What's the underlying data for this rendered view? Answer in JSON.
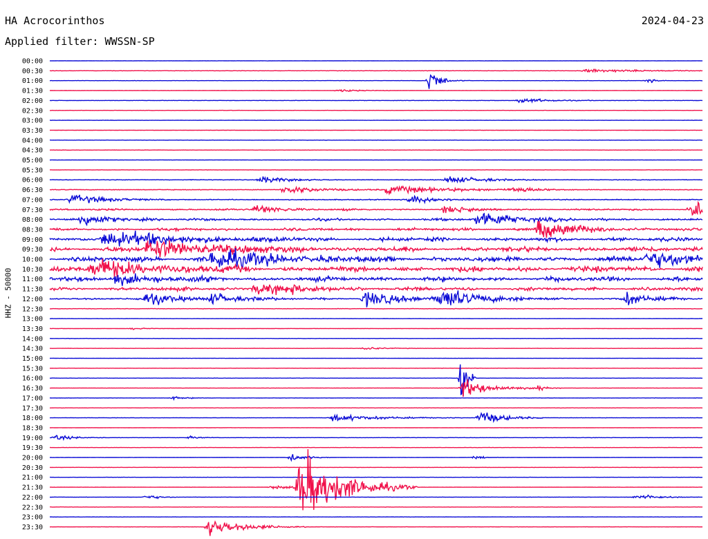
{
  "header": {
    "station": "HA Acrocorinthos",
    "date": "2024-04-23",
    "filter": "Applied filter: WWSSN-SP"
  },
  "colors": {
    "trace_a": "#0b0bd6",
    "trace_b": "#f0104a",
    "background": "#ffffff",
    "text": "#000000"
  },
  "chart_data": {
    "type": "line",
    "subtype": "helicorder",
    "title": "HA Acrocorinthos",
    "date": "2024-04-23",
    "filter": "Applied filter: WWSSN-SP",
    "ylabel": "HHZ - 50000",
    "xlabel": "",
    "minutes_per_line": 30,
    "grid": false,
    "alternate_colors": [
      "#0b0bd6",
      "#f0104a"
    ],
    "tick_labels": [
      "00:00",
      "00:30",
      "01:00",
      "01:30",
      "02:00",
      "02:30",
      "03:00",
      "03:30",
      "04:00",
      "04:30",
      "05:00",
      "05:30",
      "06:00",
      "06:30",
      "07:00",
      "07:30",
      "08:00",
      "08:30",
      "09:00",
      "09:30",
      "10:00",
      "10:30",
      "11:00",
      "11:30",
      "12:00",
      "12:30",
      "13:00",
      "13:30",
      "14:00",
      "14:30",
      "15:00",
      "15:30",
      "16:00",
      "16:30",
      "17:00",
      "17:30",
      "18:00",
      "18:30",
      "19:00",
      "19:30",
      "20:00",
      "20:30",
      "21:00",
      "21:30",
      "22:00",
      "22:30",
      "23:00",
      "23:30"
    ],
    "line_activity": [
      0.25,
      0.3,
      0.25,
      0.25,
      0.35,
      0.25,
      0.25,
      0.25,
      0.25,
      0.25,
      0.25,
      0.25,
      0.5,
      0.6,
      0.8,
      1.0,
      1.3,
      1.6,
      2.2,
      2.8,
      3.0,
      3.2,
      2.6,
      2.0,
      1.4,
      0.4,
      0.25,
      0.25,
      0.25,
      0.25,
      0.25,
      0.25,
      0.25,
      0.3,
      0.25,
      0.25,
      0.3,
      0.25,
      0.3,
      0.25,
      0.25,
      0.25,
      0.25,
      0.25,
      0.3,
      0.25,
      0.25,
      0.25
    ],
    "events": [
      {
        "line": 1,
        "minute": 24.6,
        "amp": 4,
        "dur": 2.0
      },
      {
        "line": 2,
        "minute": 17.5,
        "amp": 28,
        "dur": 0.3
      },
      {
        "line": 2,
        "minute": 18.0,
        "amp": 4,
        "dur": 0.5
      },
      {
        "line": 2,
        "minute": 27.5,
        "amp": 5,
        "dur": 0.3
      },
      {
        "line": 3,
        "minute": 13.3,
        "amp": 3,
        "dur": 0.8
      },
      {
        "line": 4,
        "minute": 21.6,
        "amp": 5,
        "dur": 1.2
      },
      {
        "line": 12,
        "minute": 9.7,
        "amp": 7,
        "dur": 1.2
      },
      {
        "line": 12,
        "minute": 18.3,
        "amp": 8,
        "dur": 1.5
      },
      {
        "line": 13,
        "minute": 10.8,
        "amp": 8,
        "dur": 1.5
      },
      {
        "line": 13,
        "minute": 15.5,
        "amp": 9,
        "dur": 2.5
      },
      {
        "line": 13,
        "minute": 21.3,
        "amp": 6,
        "dur": 1.0
      },
      {
        "line": 14,
        "minute": 1.0,
        "amp": 10,
        "dur": 1.5
      },
      {
        "line": 14,
        "minute": 16.6,
        "amp": 9,
        "dur": 1.0
      },
      {
        "line": 15,
        "minute": 9.5,
        "amp": 10,
        "dur": 1.0
      },
      {
        "line": 15,
        "minute": 18.2,
        "amp": 8,
        "dur": 1.0
      },
      {
        "line": 15,
        "minute": 29.5,
        "amp": 14,
        "dur": 2.0
      },
      {
        "line": 16,
        "minute": 1.5,
        "amp": 12,
        "dur": 1.2
      },
      {
        "line": 16,
        "minute": 19.7,
        "amp": 18,
        "dur": 1.5
      },
      {
        "line": 17,
        "minute": 22.5,
        "amp": 20,
        "dur": 1.5
      },
      {
        "line": 18,
        "minute": 2.5,
        "amp": 16,
        "dur": 3.0
      },
      {
        "line": 19,
        "minute": 4.5,
        "amp": 18,
        "dur": 3.0
      },
      {
        "line": 20,
        "minute": 7.5,
        "amp": 20,
        "dur": 2.5
      },
      {
        "line": 20,
        "minute": 27.5,
        "amp": 16,
        "dur": 2.5
      },
      {
        "line": 21,
        "minute": 2.0,
        "amp": 18,
        "dur": 2.5
      },
      {
        "line": 22,
        "minute": 3.0,
        "amp": 12,
        "dur": 1.5
      },
      {
        "line": 23,
        "minute": 9.5,
        "amp": 12,
        "dur": 2.0
      },
      {
        "line": 24,
        "minute": 4.5,
        "amp": 12,
        "dur": 1.2
      },
      {
        "line": 24,
        "minute": 7.5,
        "amp": 12,
        "dur": 1.0
      },
      {
        "line": 24,
        "minute": 14.5,
        "amp": 14,
        "dur": 1.5
      },
      {
        "line": 24,
        "minute": 18.0,
        "amp": 22,
        "dur": 1.5
      },
      {
        "line": 24,
        "minute": 26.5,
        "amp": 14,
        "dur": 0.8
      },
      {
        "line": 27,
        "minute": 3.8,
        "amp": 2,
        "dur": 0.5
      },
      {
        "line": 29,
        "minute": 14.5,
        "amp": 3,
        "dur": 0.8
      },
      {
        "line": 32,
        "minute": 19.0,
        "amp": 75,
        "dur": 0.2
      },
      {
        "line": 33,
        "minute": 19.0,
        "amp": 18,
        "dur": 1.2
      },
      {
        "line": 33,
        "minute": 22.6,
        "amp": 8,
        "dur": 0.3
      },
      {
        "line": 34,
        "minute": 5.7,
        "amp": 3,
        "dur": 0.6
      },
      {
        "line": 36,
        "minute": 13.0,
        "amp": 7,
        "dur": 2.0
      },
      {
        "line": 36,
        "minute": 19.8,
        "amp": 14,
        "dur": 1.0
      },
      {
        "line": 38,
        "minute": 0.3,
        "amp": 5,
        "dur": 0.8
      },
      {
        "line": 38,
        "minute": 6.5,
        "amp": 3,
        "dur": 0.4
      },
      {
        "line": 40,
        "minute": 11.1,
        "amp": 8,
        "dur": 0.6
      },
      {
        "line": 40,
        "minute": 19.6,
        "amp": 3,
        "dur": 0.5
      },
      {
        "line": 43,
        "minute": 10.2,
        "amp": 3,
        "dur": 2.0
      },
      {
        "line": 43,
        "minute": 11.5,
        "amp": 70,
        "dur": 1.8
      },
      {
        "line": 44,
        "minute": 4.5,
        "amp": 5,
        "dur": 0.5
      },
      {
        "line": 44,
        "minute": 27.0,
        "amp": 7,
        "dur": 0.8
      },
      {
        "line": 47,
        "minute": 7.3,
        "amp": 18,
        "dur": 1.5
      }
    ]
  }
}
